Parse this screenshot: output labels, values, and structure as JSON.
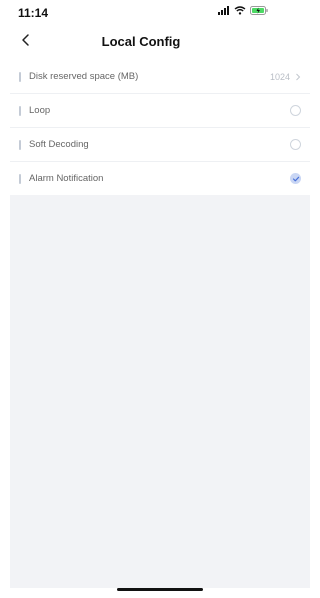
{
  "status": {
    "time": "11:14",
    "signal_icon": "signal-icon",
    "wifi_icon": "wifi-icon",
    "battery_icon": "battery-charging-icon"
  },
  "header": {
    "title": "Local Config",
    "back_icon": "chevron-left-icon"
  },
  "settings": [
    {
      "label": "Disk reserved space (MB)",
      "value": "1024",
      "control": "chevron"
    },
    {
      "label": "Loop",
      "control": "radio",
      "checked": false
    },
    {
      "label": "Soft Decoding",
      "control": "radio",
      "checked": false
    },
    {
      "label": "Alarm Notification",
      "control": "radio",
      "checked": true
    }
  ],
  "colors": {
    "accent_bar": "#c4cbd6",
    "checked_fill": "#c9d6f4",
    "checkmark": "#4a72d8",
    "background": "#f2f3f6",
    "battery_green": "#4cd964"
  }
}
